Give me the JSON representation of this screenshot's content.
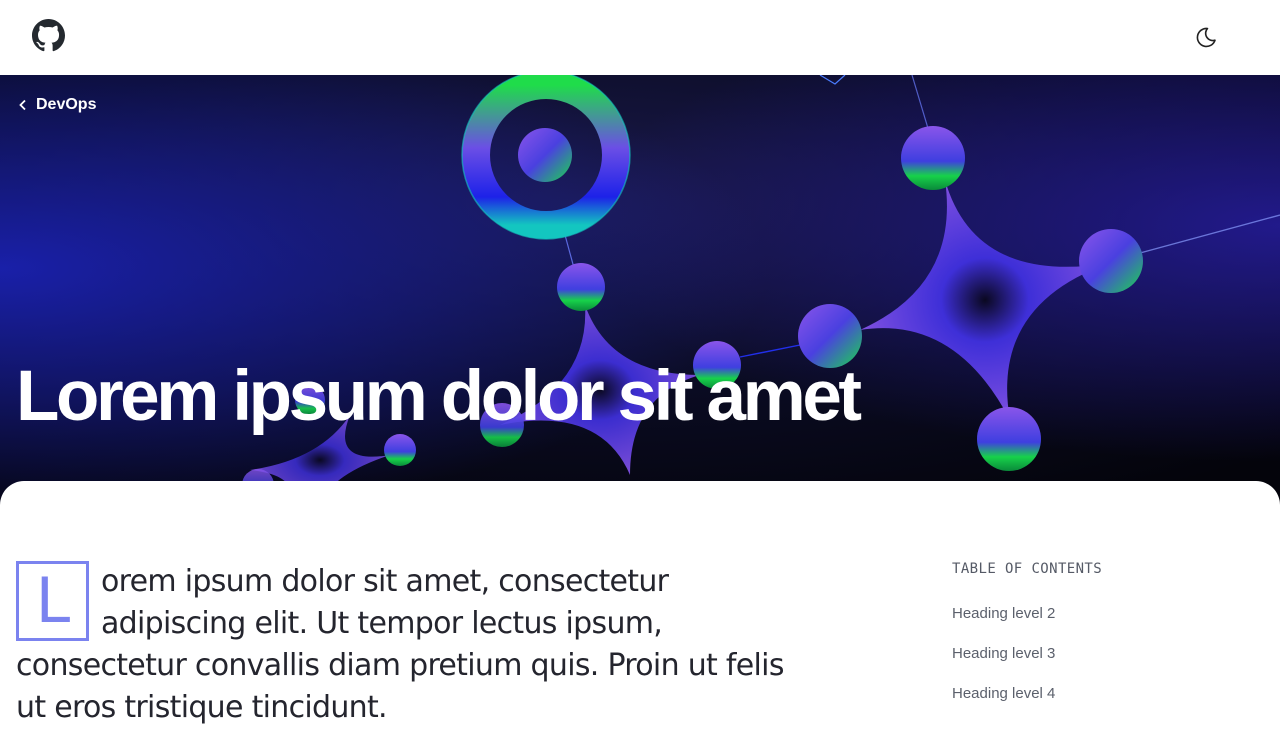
{
  "header": {
    "github_icon": "github-icon",
    "theme_toggle_icon": "moon-icon"
  },
  "hero": {
    "back_label": "DevOps",
    "back_icon": "chevron-left-icon",
    "title": "Lorem ipsum dolor sit amet"
  },
  "article": {
    "dropcap": "L",
    "lead_rest": "orem ipsum dolor sit amet, consectetur adipiscing elit. Ut tempor lectus ipsum, consectetur convallis diam pretium quis. Proin ut felis ut eros tristique tincidunt."
  },
  "toc": {
    "title": "TABLE OF CONTENTS",
    "items": [
      {
        "label": "Heading level 2"
      },
      {
        "label": "Heading level 3"
      },
      {
        "label": "Heading level 4"
      }
    ]
  },
  "colors": {
    "accent": "#7b83ef",
    "text": "#24252e",
    "hero_bg": "#05060f"
  }
}
